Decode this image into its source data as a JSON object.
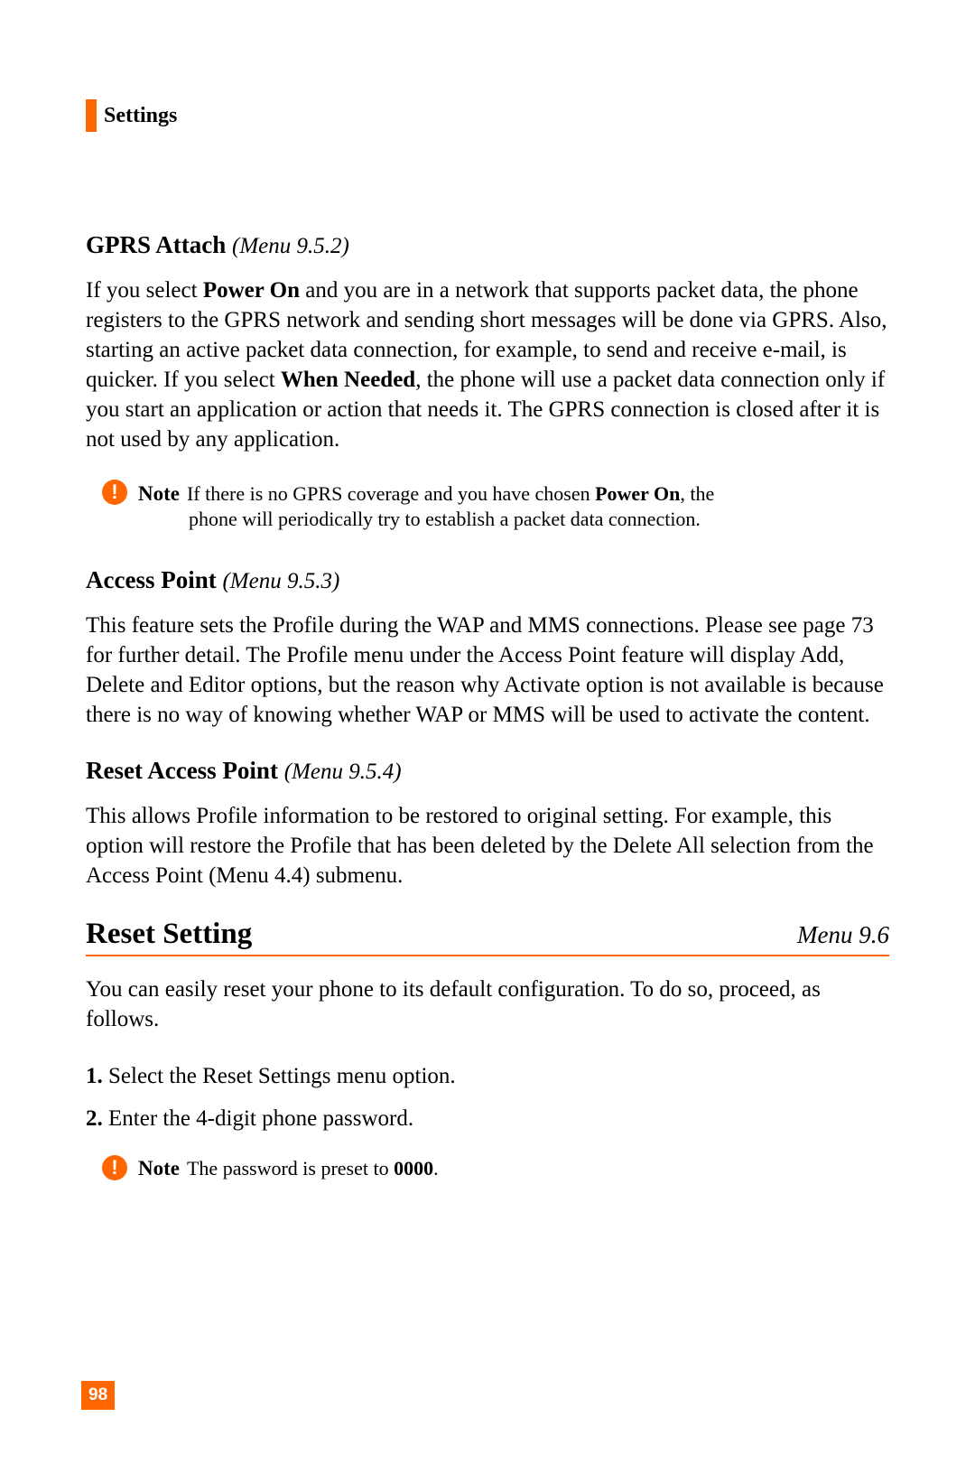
{
  "header": {
    "title": "Settings"
  },
  "sections": {
    "gprs_attach": {
      "title": "GPRS Attach",
      "menu": "(Menu 9.5.2)",
      "p1a": "If you select ",
      "p1b": "Power On",
      "p1c": " and you are in a network that supports packet data, the phone registers to the GPRS network and sending short messages will be done via GPRS. Also, starting an active packet data connection, for example, to send and receive e-mail, is quicker. If you select ",
      "p1d": "When Needed",
      "p1e": ", the phone will use a packet data connection only if you start an application or action that needs it. The GPRS connection is closed after it is not used by any application."
    },
    "note1": {
      "label": "Note",
      "t1": "If there is no GPRS coverage and you have chosen ",
      "t2": "Power On",
      "t3": ", the",
      "t4": "phone will periodically try to establish a packet data connection."
    },
    "access_point": {
      "title": "Access Point",
      "menu": "(Menu 9.5.3)",
      "p1": "This feature sets the Profile during the WAP and MMS connections. Please see page 73 for further detail. The Profile menu under the Access Point feature will display Add, Delete and Editor options, but the reason why Activate option is not available is because there is no way of knowing whether WAP or MMS will be used to activate the content."
    },
    "reset_ap": {
      "title": "Reset Access Point",
      "menu": "(Menu 9.5.4)",
      "p1": "This allows Profile information to be restored to original setting. For example, this option will restore the Profile that has been deleted by the Delete All selection from the Access Point (Menu 4.4) submenu."
    },
    "reset_setting": {
      "title": "Reset Setting",
      "menu": "Menu 9.6",
      "p1": "You can easily reset your phone to its default configuration. To do so, proceed, as follows.",
      "step1_num": "1.",
      "step1": " Select the Reset Settings menu option.",
      "step2_num": "2.",
      "step2": " Enter the 4-digit phone password."
    },
    "note2": {
      "label": "Note",
      "t1": "The password is preset to ",
      "t2": "0000",
      "t3": "."
    }
  },
  "page_number": "98"
}
